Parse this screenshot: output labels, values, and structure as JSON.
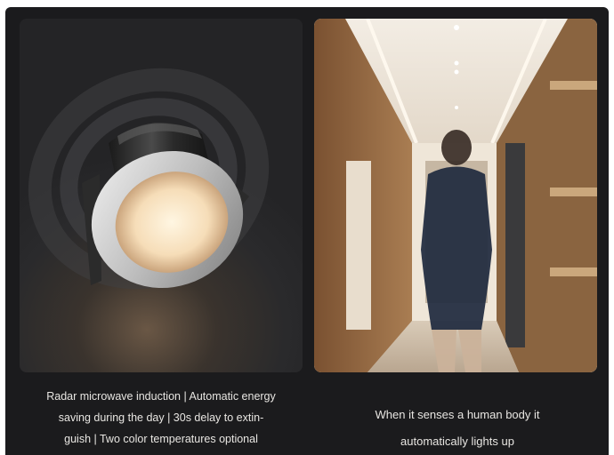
{
  "left_panel": {
    "image": "recessed-radar-downlight-photo",
    "caption_lines": [
      "Radar microwave induction  |  Automatic energy",
      "saving during the day  |  30s delay to extin-",
      "guish  |  Two color temperatures optional"
    ]
  },
  "right_panel": {
    "image": "hallway-person-walking-photo",
    "caption_lines": [
      "When it senses a human body it",
      "automatically lights up"
    ]
  }
}
